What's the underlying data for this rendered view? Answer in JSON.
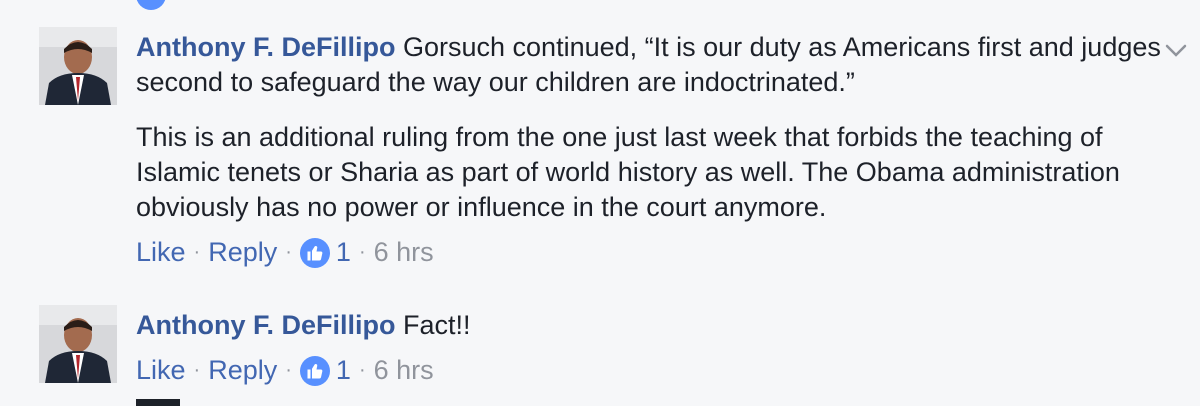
{
  "comments": [
    {
      "author": "Anthony F. DeFillipo",
      "text_lines": [
        "Gorsuch continued, “It is our duty as Americans first and judges second to safeguard the way our children are indoctrinated.”",
        "This is an additional ruling from the one just last week that forbids the teaching of Islamic tenets or Sharia as part of world history as well. The Obama administration obviously has no power or influence in the court anymore."
      ],
      "actions": {
        "like": "Like",
        "reply": "Reply",
        "reactions": "1",
        "time": "6 hrs"
      }
    },
    {
      "author": "Anthony F. DeFillipo",
      "text_lines": [
        "Fact!!"
      ],
      "actions": {
        "like": "Like",
        "reply": "Reply",
        "reactions": "1",
        "time": "6 hrs"
      }
    }
  ],
  "colors": {
    "author": "#365899",
    "link": "#4267b2",
    "meta": "#90949c",
    "reaction": "#5890ff",
    "background": "#f6f7f9"
  },
  "icons": {
    "reaction": "thumbs-up-icon",
    "options": "chevron-down-icon"
  }
}
